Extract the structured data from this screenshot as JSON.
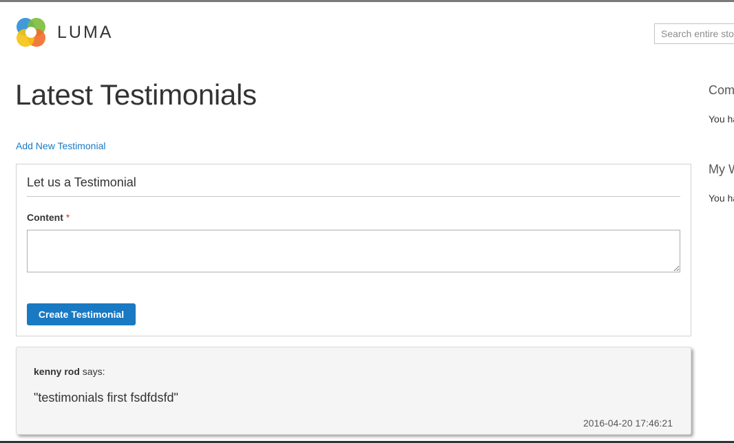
{
  "brand": {
    "name": "LUMA"
  },
  "header": {
    "search_placeholder": "Search entire store here..."
  },
  "main": {
    "title": "Latest Testimonials",
    "add_link": "Add New Testimonial",
    "form": {
      "legend": "Let us a Testimonial",
      "content_label": "Content",
      "required_mark": "*",
      "content_value": "",
      "submit_label": "Create Testimonial"
    },
    "testimonials": [
      {
        "author": "kenny rod",
        "says": "says:",
        "text": "\"testimonials first fsdfdsfd\"",
        "date": "2016-04-20 17:46:21"
      }
    ]
  },
  "sidebar": {
    "compare": {
      "title": "Compare Products",
      "text": "You have no items to compare."
    },
    "wishlist": {
      "title": "My Wish List",
      "text": "You have no items in your wish list."
    }
  },
  "colors": {
    "accent": "#1979c3",
    "required": "#e02b27",
    "card_bg": "#f5f5f6"
  }
}
